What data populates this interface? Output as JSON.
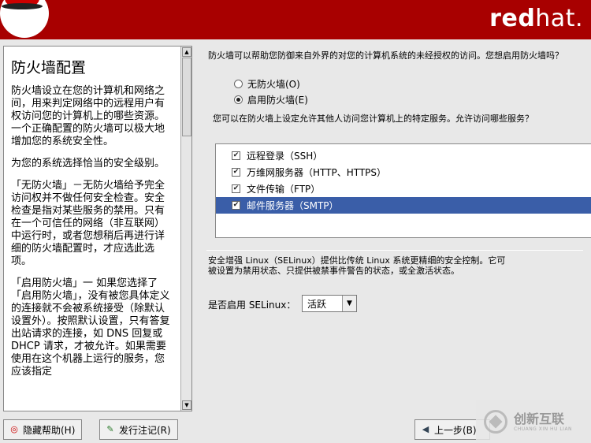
{
  "header": {
    "logo_bold": "red",
    "logo_light": "hat."
  },
  "help": {
    "title": "防火墙配置",
    "paragraphs": [
      "防火墙设立在您的计算机和网络之间，用来判定网络中的远程用户有权访问您的计算机上的哪些资源。一个正确配置的防火墙可以极大地增加您的系统安全性。",
      "为您的系统选择恰当的安全级别。",
      "「无防火墙」－无防火墙给予完全访问权并不做任何安全检查。安全检查是指对某些服务的禁用。只有在一个可信任的网络（非互联网）中运行时，或者您想稍后再进行详细的防火墙配置时，才应选此选项。",
      "「启用防火墙」一 如果您选择了「启用防火墙」，没有被您具体定义的连接就不会被系统接受（除默认设置外）。按照默认设置，只有答复出站请求的连接，如 DNS 回复或 DHCP 请求，才被允许。如果需要使用在这个机器上运行的服务，您应该指定"
    ]
  },
  "firewall": {
    "intro": "防火墙可以帮助您防御来自外界的对您的计算机系统的未经授权的访问。您想启用防火墙吗？",
    "option_none": "无防火墙(O)",
    "option_enable": "启用防火墙(E)",
    "services_label": "您可以在防火墙上设定允许其他人访问您计算机上的特定服务。允许访问哪些服务？",
    "services": [
      {
        "label": "远程登录（SSH）",
        "checked": true
      },
      {
        "label": "万维网服务器（HTTP、HTTPS）",
        "checked": true
      },
      {
        "label": "文件传输（FTP）",
        "checked": true
      },
      {
        "label": "邮件服务器（SMTP）",
        "checked": true
      }
    ]
  },
  "selinux": {
    "description": "安全增强 Linux（SELinux）提供比传统 Linux 系统更精细的安全控制。它可被设置为禁用状态、只提供被禁事件警告的状态，或全激活状态。",
    "label": "是否启用 SELinux：",
    "value": "活跃"
  },
  "buttons": {
    "hide_help": "隐藏帮助(H)",
    "release_notes": "发行注记(R)",
    "back": "上一步(B)"
  },
  "watermark": {
    "name": "创新互联",
    "sub": "CHUANG XIN HU LIAN"
  },
  "colors": {
    "banner": "#a80000",
    "selection": "#3a5ea8"
  }
}
